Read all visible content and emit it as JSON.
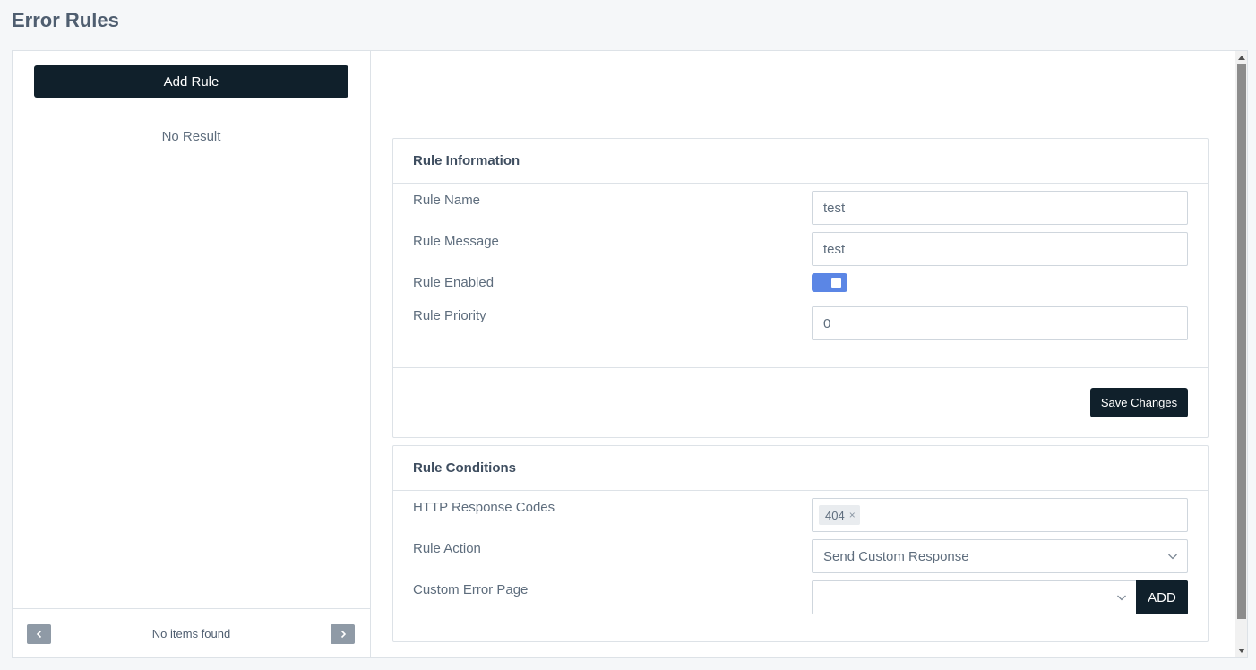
{
  "page": {
    "title": "Error Rules"
  },
  "sidebar": {
    "add_rule_label": "Add Rule",
    "empty_text": "No Result",
    "footer_text": "No items found"
  },
  "rule_info": {
    "heading": "Rule Information",
    "name_label": "Rule Name",
    "name_value": "test",
    "message_label": "Rule Message",
    "message_value": "test",
    "enabled_label": "Rule Enabled",
    "enabled": true,
    "priority_label": "Rule Priority",
    "priority_value": "0",
    "save_label": "Save Changes"
  },
  "rule_conditions": {
    "heading": "Rule Conditions",
    "codes_label": "HTTP Response Codes",
    "codes": [
      "404"
    ],
    "action_label": "Rule Action",
    "action_value": "Send Custom Response",
    "page_label": "Custom Error Page",
    "page_value": "",
    "add_label": "ADD"
  },
  "colors": {
    "dark_button": "#10202b",
    "toggle_on": "#5b86e5"
  },
  "icons": {
    "prev": "chevron-left-icon",
    "next": "chevron-right-icon",
    "dropdown": "chevron-down-icon",
    "remove_tag": "close-icon"
  }
}
